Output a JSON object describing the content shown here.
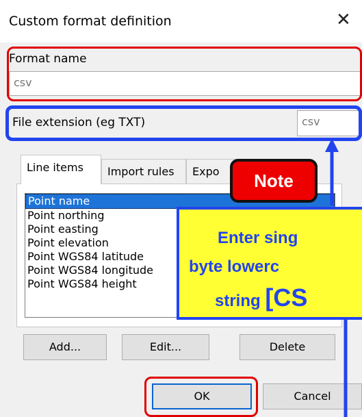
{
  "dialog": {
    "title": "Custom format definition"
  },
  "format_name": {
    "label": "Format name",
    "value": "csv"
  },
  "file_extension": {
    "label": "File extension (eg TXT)",
    "value": "csv"
  },
  "tabs": [
    {
      "label": "Line items"
    },
    {
      "label": "Import rules"
    },
    {
      "label": "Expo"
    }
  ],
  "line_items": [
    "Point name",
    "Point northing",
    "Point easting",
    "Point elevation",
    "Point WGS84 latitude",
    "Point WGS84 longitude",
    "Point WGS84 height"
  ],
  "list_buttons": {
    "add": "Add...",
    "edit": "Edit...",
    "delete": "Delete"
  },
  "dialog_buttons": {
    "ok": "OK",
    "cancel": "Cancel"
  },
  "annotation": {
    "badge": "Note",
    "line1": "Enter sing",
    "line2": "byte lowerc",
    "line3_prefix": "string ",
    "line3_big": "[CS"
  },
  "colors": {
    "highlight_red": "#e00000",
    "highlight_blue": "#2244ee",
    "note_yellow": "#ffff33",
    "selection": "#1e73d8"
  }
}
